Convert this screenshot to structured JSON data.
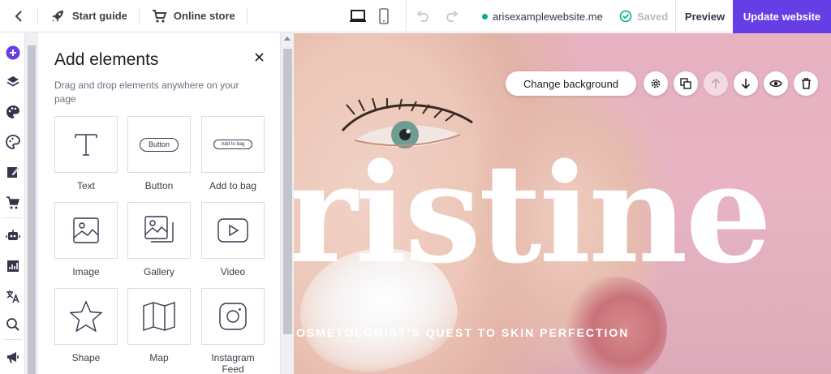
{
  "topbar": {
    "start_guide": "Start guide",
    "online_store": "Online store",
    "url": "arisexamplewebsite.me",
    "saved": "Saved",
    "preview": "Preview",
    "update": "Update website",
    "accent_color": "#673de6"
  },
  "rail": {
    "icons": [
      "add-element-icon",
      "layers-icon",
      "palette-icon",
      "styles-icon",
      "edit-page-icon",
      "cart-icon",
      "ai-robot-icon",
      "analytics-icon",
      "translate-icon",
      "search-icon",
      "announcement-icon"
    ]
  },
  "panel": {
    "title": "Add elements",
    "description": "Drag and drop elements anywhere on your page",
    "elements": [
      {
        "label": "Text",
        "icon": "text-icon"
      },
      {
        "label": "Button",
        "icon": "button-icon",
        "preview": "Button"
      },
      {
        "label": "Add to bag",
        "icon": "add-to-bag-icon",
        "preview": "Add to bag"
      },
      {
        "label": "Image",
        "icon": "image-icon"
      },
      {
        "label": "Gallery",
        "icon": "gallery-icon"
      },
      {
        "label": "Video",
        "icon": "video-icon"
      },
      {
        "label": "Shape",
        "icon": "star-icon"
      },
      {
        "label": "Map",
        "icon": "map-icon"
      },
      {
        "label": "Instagram Feed",
        "icon": "instagram-icon"
      }
    ]
  },
  "canvas": {
    "hero_title": "ristine",
    "hero_subtitle": "OSMETOLOGIST’S QUEST TO SKIN PERFECTION",
    "change_background": "Change background"
  }
}
